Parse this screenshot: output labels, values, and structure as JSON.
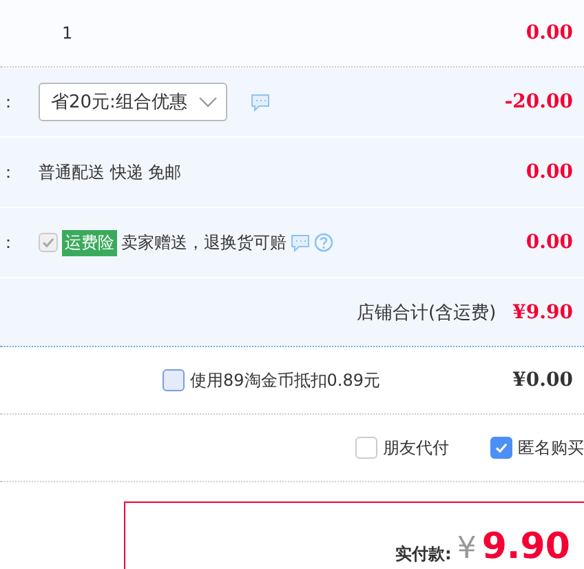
{
  "item_row": {
    "quantity": "1",
    "amount": "0.00"
  },
  "order_rows": [
    {
      "kind": "select",
      "label": "：",
      "value": "省20元:组合优惠",
      "amount": "-20.00"
    },
    {
      "kind": "text",
      "label": "：",
      "text": "普通配送 快递 免邮",
      "amount": "0.00"
    },
    {
      "kind": "insurance",
      "label": "：",
      "checked": true,
      "disabled": true,
      "tag": "运费险",
      "text": "卖家赠送，退换货可赔",
      "amount": "0.00"
    }
  ],
  "shop_total": {
    "label": "店铺合计(含运费)",
    "amount": "¥9.90"
  },
  "coins": {
    "checked": false,
    "label": "使用89淘金币抵扣0.89元",
    "amount": "¥0.00"
  },
  "options": [
    {
      "label": "朋友代付",
      "checked": false
    },
    {
      "label": "匿名购买",
      "checked": true
    }
  ],
  "payment": {
    "label": "实付款:",
    "currency": "¥",
    "amount": "9.90"
  }
}
